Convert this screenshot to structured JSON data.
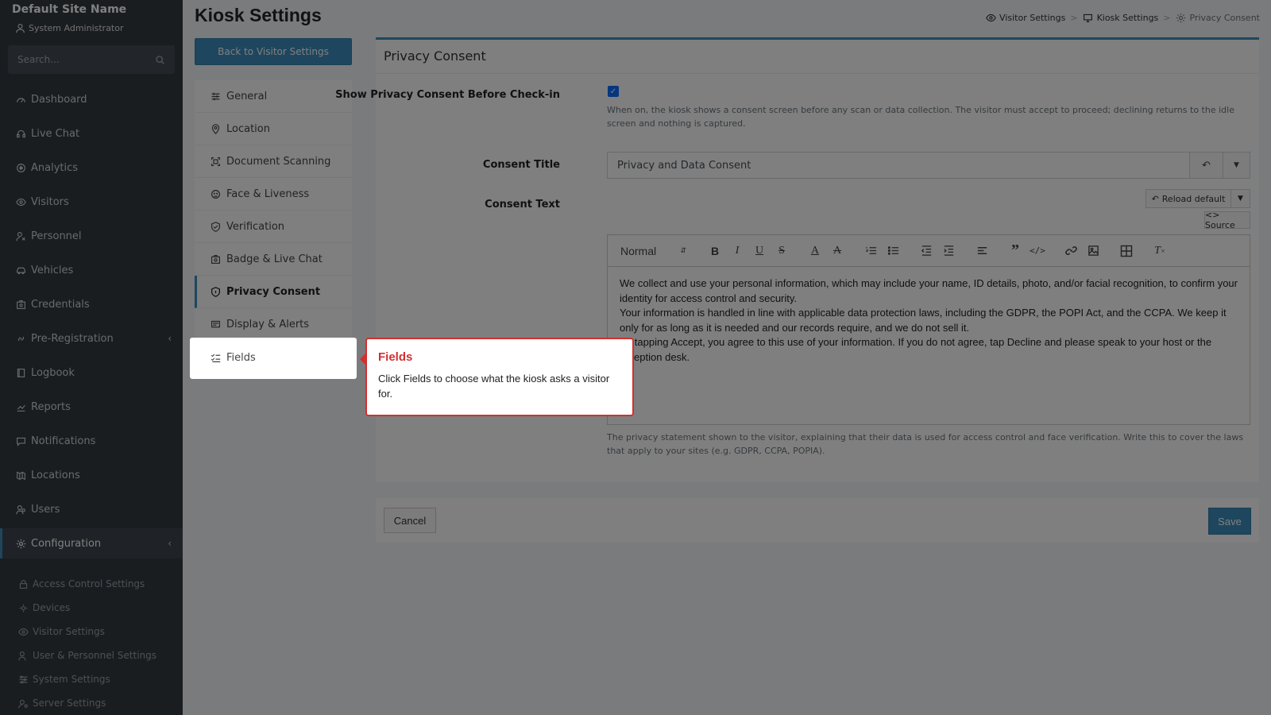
{
  "sidebar": {
    "site_name": "Default Site Name",
    "user_role": "System Administrator",
    "search_placeholder": "Search...",
    "items": [
      {
        "label": "Dashboard",
        "icon": "dashboard-icon"
      },
      {
        "label": "Live Chat",
        "icon": "headset-icon"
      },
      {
        "label": "Analytics",
        "icon": "analytics-icon"
      },
      {
        "label": "Visitors",
        "icon": "eye-icon"
      },
      {
        "label": "Personnel",
        "icon": "personnel-icon"
      },
      {
        "label": "Vehicles",
        "icon": "car-icon"
      },
      {
        "label": "Credentials",
        "icon": "badge-icon"
      },
      {
        "label": "Pre-Registration",
        "icon": "link-icon"
      },
      {
        "label": "Logbook",
        "icon": "book-icon"
      },
      {
        "label": "Reports",
        "icon": "chart-icon"
      },
      {
        "label": "Notifications",
        "icon": "chat-icon"
      },
      {
        "label": "Locations",
        "icon": "map-icon"
      },
      {
        "label": "Users",
        "icon": "users-icon"
      },
      {
        "label": "Configuration",
        "icon": "gear-icon"
      }
    ],
    "sub_items": [
      {
        "label": "Access Control Settings"
      },
      {
        "label": "Devices"
      },
      {
        "label": "Visitor Settings"
      },
      {
        "label": "User & Personnel Settings"
      },
      {
        "label": "System Settings"
      },
      {
        "label": "Server Settings"
      }
    ]
  },
  "header": {
    "title": "Kiosk Settings",
    "breadcrumb": [
      "Visitor Settings",
      "Kiosk Settings",
      "Privacy Consent"
    ]
  },
  "back_button": "Back to Visitor Settings",
  "settings_nav": [
    {
      "label": "General"
    },
    {
      "label": "Location"
    },
    {
      "label": "Document Scanning"
    },
    {
      "label": "Face & Liveness"
    },
    {
      "label": "Verification"
    },
    {
      "label": "Badge & Live Chat"
    },
    {
      "label": "Privacy Consent"
    },
    {
      "label": "Display & Alerts"
    },
    {
      "label": "Fields"
    }
  ],
  "form": {
    "card_title": "Privacy Consent",
    "show_consent_label": "Show Privacy Consent Before Check-in",
    "show_consent_checked": true,
    "show_consent_help": "When on, the kiosk shows a consent screen before any scan or data collection. The visitor must accept to proceed; declining returns to the idle screen and nothing is captured.",
    "consent_title_label": "Consent Title",
    "consent_title_value": "Privacy and Data Consent",
    "consent_text_label": "Consent Text",
    "reload_default": "Reload default",
    "source_button": "<> Source",
    "format_select": "Normal",
    "consent_text": [
      "We collect and use your personal information, which may include your name, ID details, photo, and/or facial recognition, to confirm your identity for access control and security.",
      "Your information is handled in line with applicable data protection laws, including the GDPR, the POPI Act, and the CCPA. We keep it only for as long as it is needed and our records require, and we do not sell it.",
      "By tapping Accept, you agree to this use of your information. If you do not agree, tap Decline and please speak to your host or the reception desk."
    ],
    "consent_text_help": "The privacy statement shown to the visitor, explaining that their data is used for access control and face verification. Write this to cover the laws that apply to your sites (e.g. GDPR, CCPA, POPIA).",
    "cancel": "Cancel",
    "save": "Save"
  },
  "tooltip": {
    "title": "Fields",
    "body": "Click Fields to choose what the kiosk asks a visitor for."
  },
  "colors": {
    "sidebar_bg": "#343a40",
    "accent": "#3c8dbc",
    "tooltip_border": "#d32f2f"
  }
}
